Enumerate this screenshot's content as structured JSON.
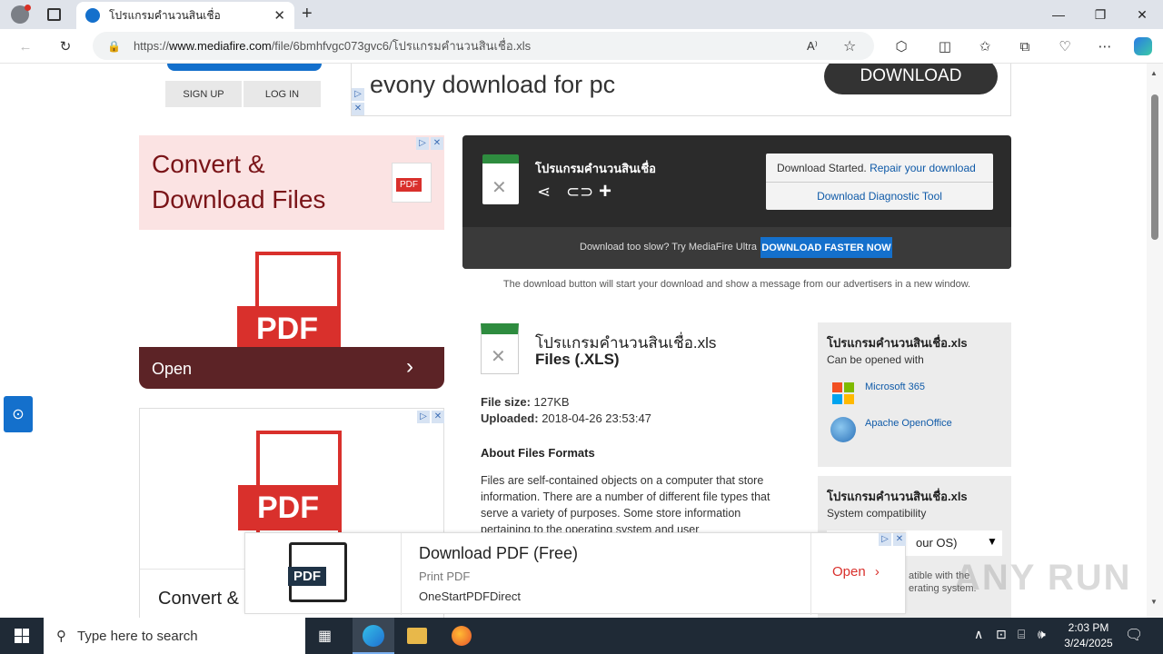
{
  "browser": {
    "tab_title": "โปรแกรมคำนวนสินเชื่อ",
    "url_prefix": "https://",
    "url_domain": "www.mediafire.com",
    "url_path": "/file/6bmhfvgc073gvc6/โปรแกรมคำนวนสินเชื่อ.xls"
  },
  "header": {
    "signup": "SIGN UP",
    "login": "LOG IN",
    "ad_text": "evony download for pc",
    "ad_button": "DOWNLOAD"
  },
  "left_ad": {
    "headline_1": "Convert &",
    "headline_2": "Download Files",
    "pdf_badge": "PDF",
    "pdf_big": "PDF",
    "open_label": "Open",
    "pdf_big_2": "PDF",
    "headline_3": "Convert &"
  },
  "download": {
    "file_title": "โปรแกรมคำนวนสินเชื่อ",
    "status_text": "Download Started.",
    "repair_link": "Repair your download",
    "diag_link": "Download Diagnostic Tool",
    "slow_text": "Download too slow? Try MediaFire Ultra",
    "faster_button": "DOWNLOAD FASTER NOW",
    "note": "The download button will start your download and show a message from our advertisers in a new window."
  },
  "file_info": {
    "name": "โปรแกรมคำนวนสินเชื่อ.xls",
    "type": "Files (.XLS)",
    "size_label": "File size:",
    "size_value": "127KB",
    "uploaded_label": "Uploaded:",
    "uploaded_value": "2018-04-26 23:53:47",
    "about_heading": "About Files Formats",
    "about_text": "Files are self-contained objects on a computer that store information. There are a number of different file types that serve a variety of purposes. Some store information pertaining to the operating system and user"
  },
  "side_box_1": {
    "title": "โปรแกรมคำนวนสินเชื่อ.xls",
    "subtitle": "Can be opened with",
    "app_1": "Microsoft 365",
    "app_2": "Apache OpenOffice"
  },
  "side_box_2": {
    "title": "โปรแกรมคำนวนสินเชื่อ.xls",
    "subtitle": "System compatibility",
    "select_value": "our OS)",
    "compat_1": "atible with the",
    "compat_2": "erating system."
  },
  "bottom_ad": {
    "title": "Download PDF (Free)",
    "sub": "Print PDF",
    "brand": "OneStartPDFDirect",
    "open": "Open",
    "pdf_icon": "PDF"
  },
  "watermark": "ANY RUN",
  "taskbar": {
    "search_placeholder": "Type here to search",
    "time": "2:03 PM",
    "date": "3/24/2025"
  },
  "colors": {
    "accent": "#1470cc",
    "dark_panel": "#2b2b2b",
    "ad_red": "#7a1418",
    "pdf_red": "#d9302c"
  }
}
